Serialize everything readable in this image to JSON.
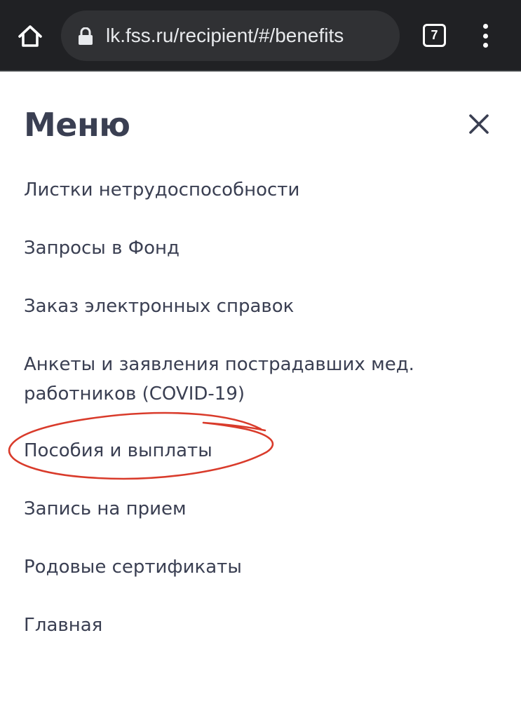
{
  "browser": {
    "url": "lk.fss.ru/recipient/#/benefits",
    "tab_count": "7",
    "icons": {
      "home": "home-icon",
      "lock": "lock-icon",
      "tabs": "tabs-icon",
      "more": "more-vert-icon"
    }
  },
  "menu": {
    "title": "Меню",
    "close_icon": "close-icon",
    "items": [
      {
        "label": "Листки нетрудоспособности"
      },
      {
        "label": "Запросы в Фонд"
      },
      {
        "label": "Заказ электронных справок"
      },
      {
        "label_line1": "Анкеты и заявления пострадавших мед.",
        "label_line2": "работников (COVID-19)"
      },
      {
        "label": "Пособия и выплаты",
        "highlighted": true
      },
      {
        "label": "Запись на прием"
      },
      {
        "label": "Родовые сертификаты"
      },
      {
        "label": "Главная"
      }
    ]
  },
  "colors": {
    "browser_bar": "#202124",
    "url_field": "#303134",
    "text_primary": "#3a3f52",
    "annotation": "#d93b2b"
  }
}
